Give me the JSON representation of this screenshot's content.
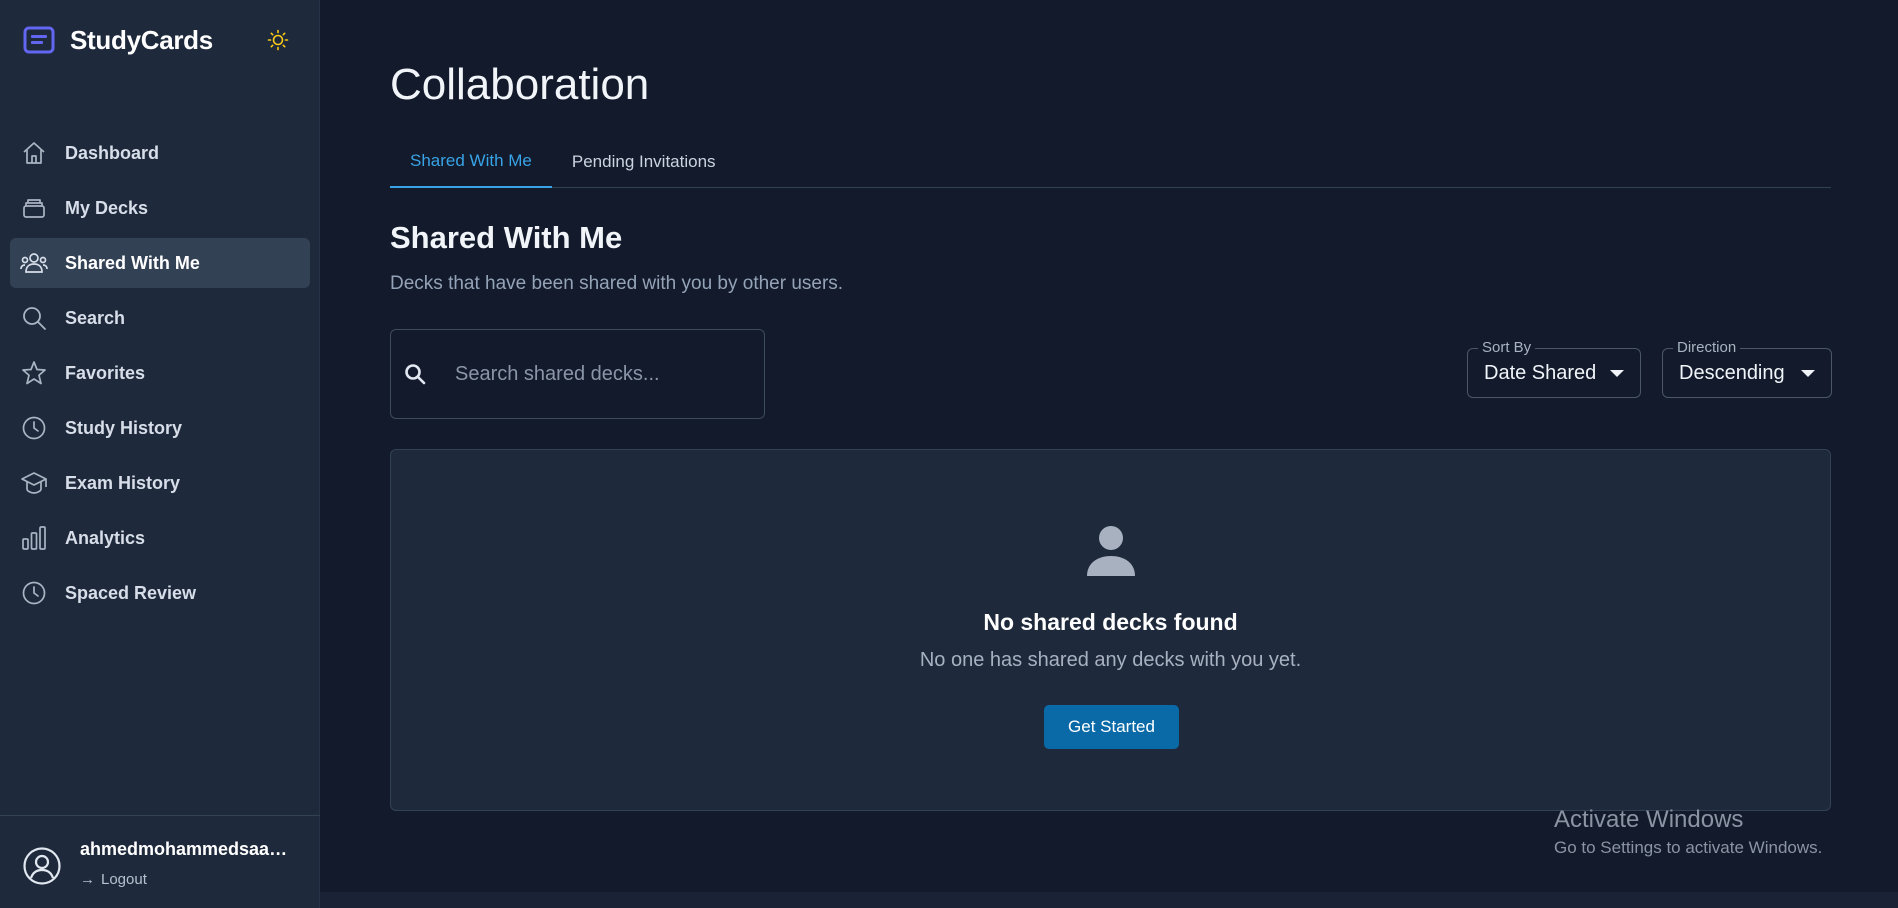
{
  "brand": {
    "name": "StudyCards"
  },
  "sidebar": {
    "items": [
      {
        "label": "Dashboard",
        "icon": "home-icon",
        "active": false
      },
      {
        "label": "My Decks",
        "icon": "decks-icon",
        "active": false
      },
      {
        "label": "Shared With Me",
        "icon": "users-icon",
        "active": true
      },
      {
        "label": "Search",
        "icon": "search-icon",
        "active": false
      },
      {
        "label": "Favorites",
        "icon": "star-icon",
        "active": false
      },
      {
        "label": "Study History",
        "icon": "clock-icon",
        "active": false
      },
      {
        "label": "Exam History",
        "icon": "graduation-cap-icon",
        "active": false
      },
      {
        "label": "Analytics",
        "icon": "bar-chart-icon",
        "active": false
      },
      {
        "label": "Spaced Review",
        "icon": "clock-icon",
        "active": false
      }
    ]
  },
  "user": {
    "name": "ahmedmohammedsaad...",
    "logout_label": "Logout"
  },
  "main": {
    "title": "Collaboration",
    "tabs": [
      {
        "label": "Shared With Me",
        "active": true
      },
      {
        "label": "Pending Invitations",
        "active": false
      }
    ],
    "section_title": "Shared With Me",
    "section_subtitle": "Decks that have been shared with you by other users.",
    "search": {
      "placeholder": "Search shared decks...",
      "value": ""
    },
    "sort_by": {
      "label": "Sort By",
      "value": "Date Shared"
    },
    "direction": {
      "label": "Direction",
      "value": "Descending"
    },
    "empty_state": {
      "title": "No shared decks found",
      "text": "No one has shared any decks with you yet.",
      "button_label": "Get Started"
    }
  },
  "watermark": {
    "title": "Activate Windows",
    "subtitle": "Go to Settings to activate Windows."
  },
  "colors": {
    "background": "#121a2b",
    "sidebar": "#1e293b",
    "accent": "#38a3e6",
    "button": "#0a6aa8",
    "brand_logo": "#6366f1",
    "sun": "#facc15"
  }
}
